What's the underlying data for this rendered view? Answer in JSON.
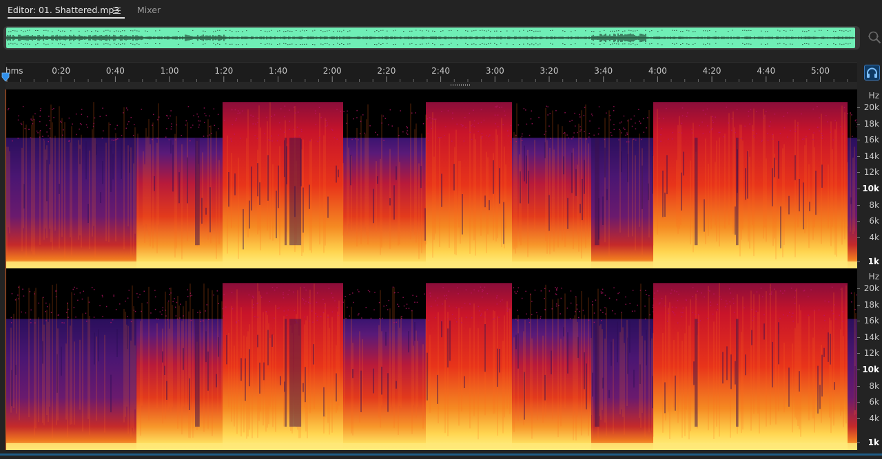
{
  "tabs": {
    "editor_label": "Editor: 01. Shattered.mp3",
    "mixer_label": "Mixer"
  },
  "overview": {
    "waveform_color": "#6fefb6"
  },
  "icons": {
    "tab_menu": "hamburger-menu-icon",
    "zoom": "zoom-magnifier-icon",
    "headphones": "headphones-icon",
    "playhead": "playhead-marker-icon"
  },
  "ruler": {
    "unit": "hms",
    "ticks": [
      "0:20",
      "0:40",
      "1:00",
      "1:20",
      "1:40",
      "2:00",
      "2:20",
      "2:40",
      "3:00",
      "3:20",
      "3:40",
      "4:00",
      "4:20",
      "4:40",
      "5:00"
    ]
  },
  "frequency_scale": {
    "unit": "Hz",
    "labels": [
      "20k",
      "18k",
      "16k",
      "14k",
      "12k",
      "10k",
      "8k",
      "6k",
      "4k",
      "1k"
    ],
    "emphasized": [
      "10k",
      "1k"
    ]
  },
  "colors": {
    "accent": "#3c7bbd",
    "playhead": "#2f8ee8",
    "spectrogram_low": "#2a0f5c",
    "spectrogram_mid": "#d41a10",
    "spectrogram_high": "#ffe46a"
  }
}
